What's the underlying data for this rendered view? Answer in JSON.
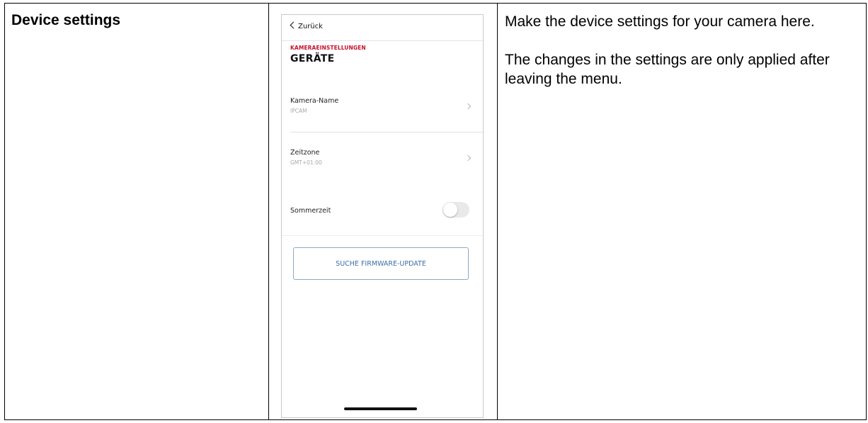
{
  "table": {
    "row_title": "Device settings",
    "description": [
      "Make the device settings for your camera here.",
      "The changes in the settings are only applied after leaving the menu."
    ]
  },
  "phone": {
    "back_label": "Zurück",
    "section_kicker": "KAMERAEINSTELLUNGEN",
    "section_title": "GERÄTE",
    "settings": [
      {
        "label": "Kamera-Name",
        "value": "IPCAM"
      },
      {
        "label": "Zeitzone",
        "value": "GMT+01:00"
      }
    ],
    "dst": {
      "label": "Sommerzeit",
      "enabled": false
    },
    "firmware_button": "SUCHE FIRMWARE-UPDATE",
    "colors": {
      "kicker": "#c8102e",
      "button_text": "#3d6ea8",
      "toggle_off": "#e9e9ea"
    },
    "icons": [
      "chevron-left-icon",
      "chevron-right-icon"
    ]
  }
}
